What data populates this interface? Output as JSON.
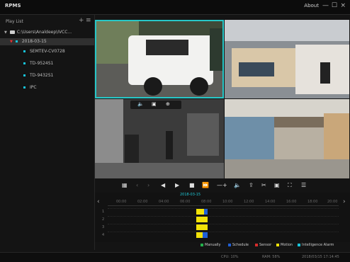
{
  "app": {
    "title": "RPMS",
    "about_label": "About",
    "win_minimize": "—",
    "win_restore": "☐",
    "win_close": "×"
  },
  "sidebar": {
    "title": "Play List",
    "add_label": "+",
    "menu_label": "≡",
    "tree": {
      "root": "C:\\Users\\Analdeep\\IVCC...",
      "date": "2018-03-15",
      "items": [
        "SEMTEV-CV0728",
        "TD-9524S1",
        "TD-9432S1",
        "IPC"
      ]
    }
  },
  "timeline": {
    "date": "2018-03-15",
    "ticks": [
      "00:00",
      "02:00",
      "04:00",
      "06:00",
      "08:00",
      "10:00",
      "12:00",
      "14:00",
      "16:00",
      "18:00",
      "20:00"
    ],
    "row_numbers": [
      "1",
      "2",
      "3",
      "4"
    ],
    "left_arrow": "‹",
    "right_arrow": "›"
  },
  "legend": {
    "items": [
      {
        "label": "Manually",
        "color": "#22b04b"
      },
      {
        "label": "Schedule",
        "color": "#1f5fd6"
      },
      {
        "label": "Sensor",
        "color": "#d62c2c"
      },
      {
        "label": "Motion",
        "color": "#f2e208"
      },
      {
        "label": "Intelligence Alarm",
        "color": "#18c3d9"
      }
    ]
  },
  "statusbar": {
    "cpu": "CPU: 10%",
    "ram": "RAM: 58%",
    "datetime": "2018/03/15 17:14:45"
  },
  "colors": {
    "accent": "#27c7c7",
    "motion": "#f2e208",
    "schedule": "#1f5fd6"
  }
}
